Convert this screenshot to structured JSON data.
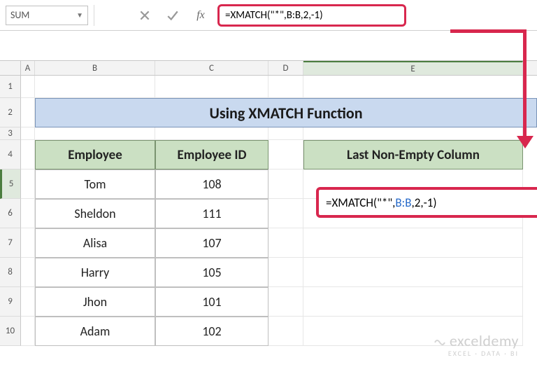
{
  "name_box": "SUM",
  "formula_bar": "=XMATCH(\"*\",B:B,2,-1)",
  "columns": {
    "A": "A",
    "B": "B",
    "C": "C",
    "D": "D",
    "E": "E"
  },
  "rows": [
    "1",
    "2",
    "3",
    "4",
    "5",
    "6",
    "7",
    "8",
    "9",
    "10"
  ],
  "title": "Using XMATCH Function",
  "headers": {
    "employee": "Employee",
    "employee_id": "Employee ID",
    "last_col": "Last Non-Empty Column"
  },
  "table": [
    {
      "emp": "Tom",
      "id": "108"
    },
    {
      "emp": "Sheldon",
      "id": "111"
    },
    {
      "emp": "Alisa",
      "id": "107"
    },
    {
      "emp": "Harry",
      "id": "105"
    },
    {
      "emp": "Jhon",
      "id": "101"
    },
    {
      "emp": "Adam",
      "id": "102"
    }
  ],
  "e5_formula": {
    "pre": "=XMATCH(\"*\",",
    "ref": "B:B",
    "post": ",2,-1)"
  },
  "watermark": {
    "line1": "exceldemy",
    "line2": "EXCEL · DATA · BI"
  }
}
